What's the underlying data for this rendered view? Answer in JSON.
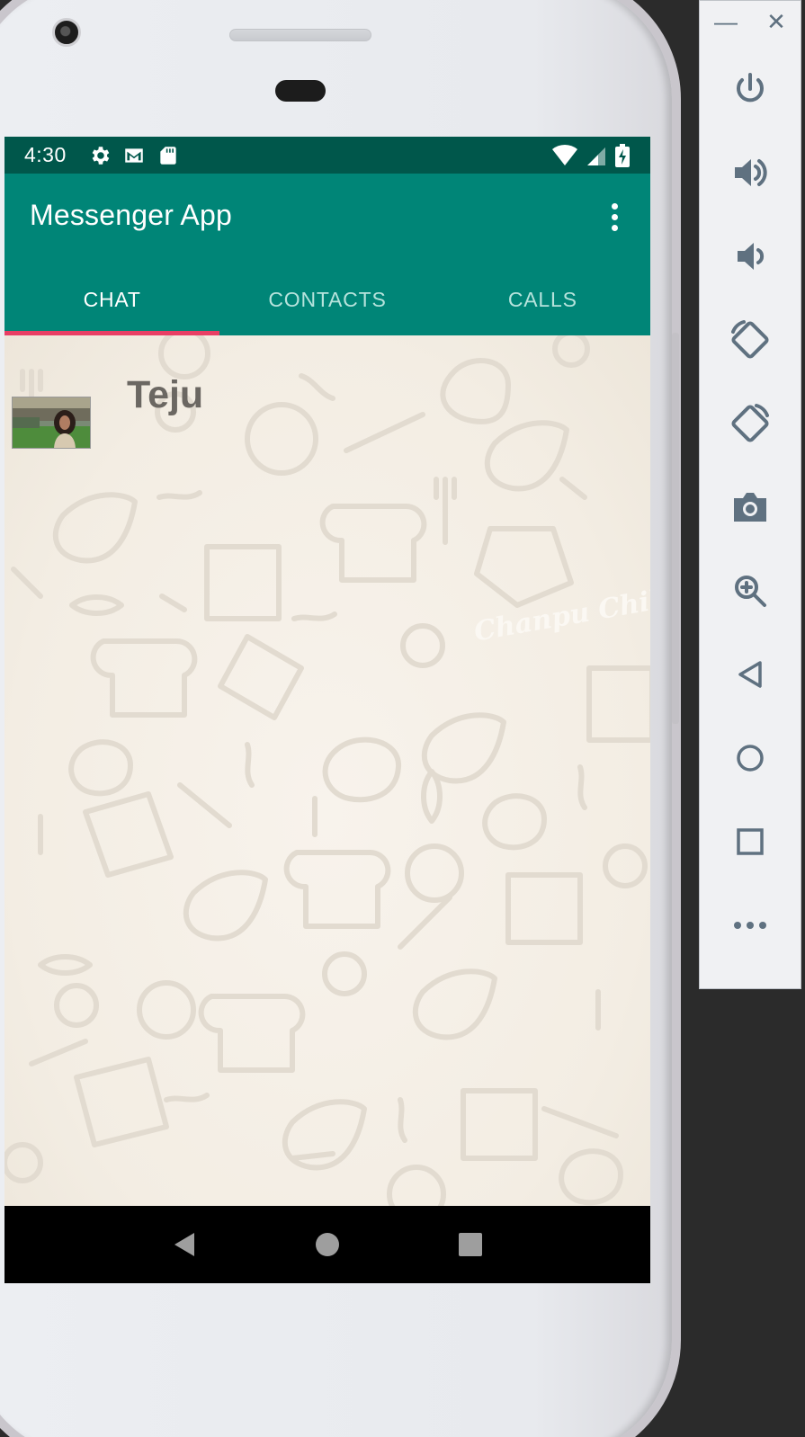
{
  "status_bar": {
    "time": "4:30",
    "left_icons": [
      "settings-icon",
      "gmail-icon",
      "sd-card-icon"
    ],
    "right_icons": [
      "wifi-icon",
      "cell-signal-icon",
      "battery-charging-icon"
    ]
  },
  "app_bar": {
    "title": "Messenger App",
    "menu_icon": "more-vert-icon"
  },
  "tabs": [
    {
      "label": "CHAT",
      "active": true
    },
    {
      "label": "CONTACTS",
      "active": false
    },
    {
      "label": "CALLS",
      "active": false
    }
  ],
  "chats": [
    {
      "name": "Teju",
      "avatar": "profile-photo"
    }
  ],
  "wallpaper": {
    "watermark": "Chanpu Chikito"
  },
  "nav_bar": [
    "back-icon",
    "home-icon",
    "recents-icon"
  ],
  "emulator_panel": {
    "window_controls": {
      "minimize": "—",
      "close": "✕"
    },
    "buttons": [
      "power-icon",
      "volume-up-icon",
      "volume-down-icon",
      "rotate-left-icon",
      "rotate-right-icon",
      "camera-icon",
      "zoom-icon",
      "back-icon",
      "home-icon",
      "overview-icon",
      "more-icon"
    ]
  },
  "colors": {
    "primary": "#008577",
    "primary_dark": "#00574B",
    "accent": "#E83F65",
    "panel_icon": "#5F7180"
  }
}
